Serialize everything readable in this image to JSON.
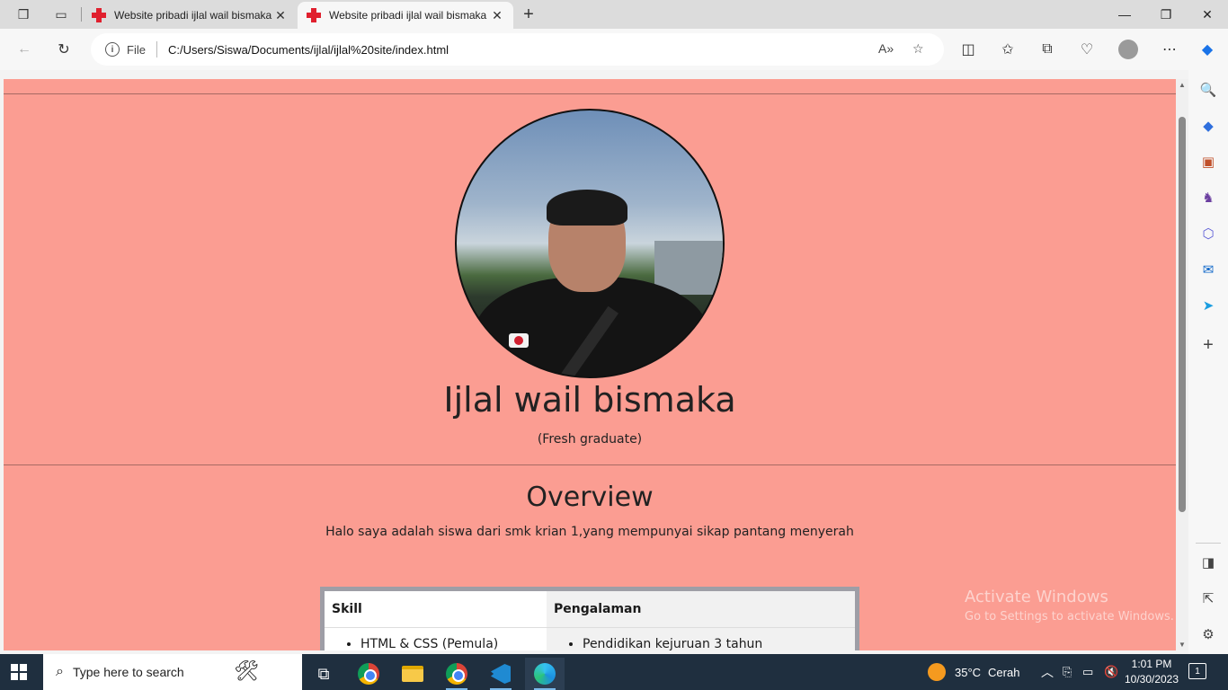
{
  "browser": {
    "tabs": [
      {
        "title": "Website pribadi ijlal wail bismaka",
        "active": false
      },
      {
        "title": "Website pribadi ijlal wail bismaka",
        "active": true
      }
    ],
    "address": {
      "scheme_label": "File",
      "url": "C:/Users/Siswa/Documents/ijlal/ijlal%20site/index.html"
    }
  },
  "page": {
    "name": "Ijlal wail bismaka",
    "subtitle": "(Fresh graduate)",
    "overview_title": "Overview",
    "overview_text": "Halo saya adalah siswa dari smk krian 1,yang mempunyai sikap pantang menyerah",
    "table": {
      "headers": [
        "Skill",
        "Pengalaman"
      ],
      "rows": [
        [
          "HTML & CSS (Pemula)",
          "Pendidikan kejuruan 3 tahun"
        ]
      ]
    },
    "background_color": "#fb9d92"
  },
  "watermark": {
    "line1": "Activate Windows",
    "line2": "Go to Settings to activate Windows."
  },
  "taskbar": {
    "search_placeholder": "Type here to search",
    "weather": {
      "temp": "35°C",
      "condition": "Cerah"
    },
    "time": "1:01 PM",
    "date": "10/30/2023",
    "notification_count": "1"
  }
}
